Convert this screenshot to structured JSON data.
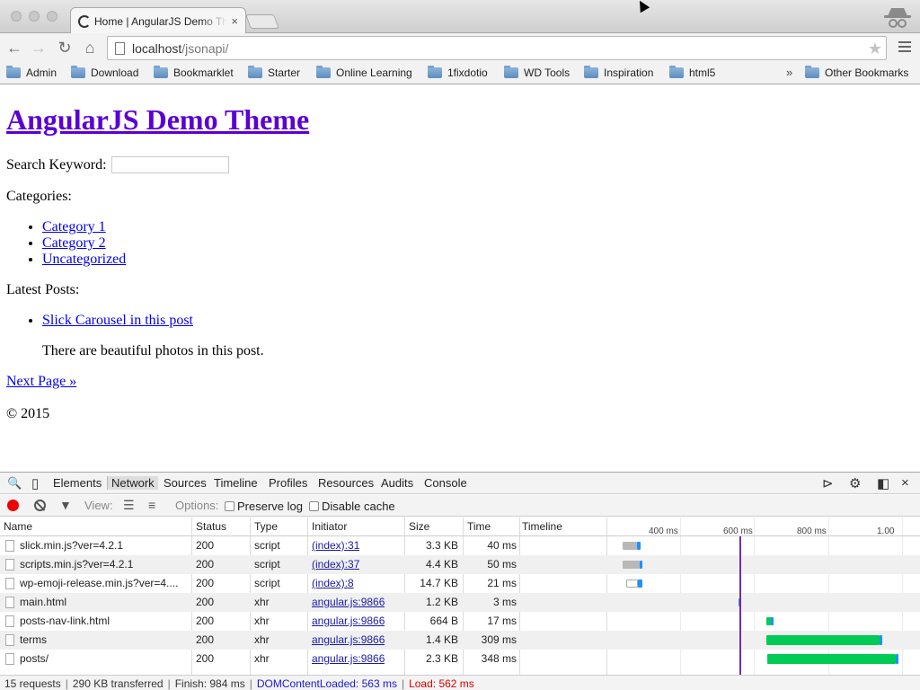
{
  "browser": {
    "tab_title": "Home | AngularJS Demo Theme",
    "tab_close": "×",
    "url_host": "localhost",
    "url_path": "/jsonapi/",
    "bookmarks": [
      "Admin",
      "Download",
      "Bookmarklet",
      "Starter",
      "Online Learning",
      "1fixdotio",
      "WD Tools",
      "Inspiration",
      "html5"
    ],
    "overflow": "»",
    "other_bookmarks": "Other Bookmarks"
  },
  "page": {
    "title": "AngularJS Demo Theme",
    "search_label": "Search Keyword:",
    "categories_label": "Categories:",
    "categories": [
      "Category 1",
      "Category 2",
      "Uncategorized"
    ],
    "latest_label": "Latest Posts:",
    "post_title": "Slick Carousel in this post",
    "post_excerpt": "There are beautiful photos in this post.",
    "next_page": "Next Page »",
    "copyright": "© 2015"
  },
  "devtools": {
    "tabs": [
      "Elements",
      "Network",
      "Sources",
      "Timeline",
      "Profiles",
      "Resources",
      "Audits",
      "Console"
    ],
    "active_tab": "Network",
    "view_label": "View:",
    "options_label": "Options:",
    "preserve_log": "Preserve log",
    "disable_cache": "Disable cache",
    "columns": [
      "Name",
      "Status",
      "Type",
      "Initiator",
      "Size",
      "Time",
      "Timeline"
    ],
    "timeline_ticks": [
      "400 ms",
      "600 ms",
      "800 ms",
      "1.00"
    ],
    "rows": [
      {
        "name": "slick.min.js?ver=4.2.1",
        "status": "200",
        "type": "script",
        "initiator": "(index):31",
        "size": "3.3 KB",
        "time": "40 ms"
      },
      {
        "name": "scripts.min.js?ver=4.2.1",
        "status": "200",
        "type": "script",
        "initiator": "(index):37",
        "size": "4.4 KB",
        "time": "50 ms"
      },
      {
        "name": "wp-emoji-release.min.js?ver=4....",
        "status": "200",
        "type": "script",
        "initiator": "(index):8",
        "size": "14.7 KB",
        "time": "21 ms"
      },
      {
        "name": "main.html",
        "status": "200",
        "type": "xhr",
        "initiator": "angular.js:9866",
        "size": "1.2 KB",
        "time": "3 ms"
      },
      {
        "name": "posts-nav-link.html",
        "status": "200",
        "type": "xhr",
        "initiator": "angular.js:9866",
        "size": "664 B",
        "time": "17 ms"
      },
      {
        "name": "terms",
        "status": "200",
        "type": "xhr",
        "initiator": "angular.js:9866",
        "size": "1.4 KB",
        "time": "309 ms"
      },
      {
        "name": "posts/",
        "status": "200",
        "type": "xhr",
        "initiator": "angular.js:9866",
        "size": "2.3 KB",
        "time": "348 ms"
      }
    ],
    "status_bar": {
      "requests": "15 requests",
      "transferred": "290 KB transferred",
      "finish": "Finish: 984 ms",
      "dom_loaded": "DOMContentLoaded: 563 ms",
      "load": "Load: 562 ms"
    }
  }
}
